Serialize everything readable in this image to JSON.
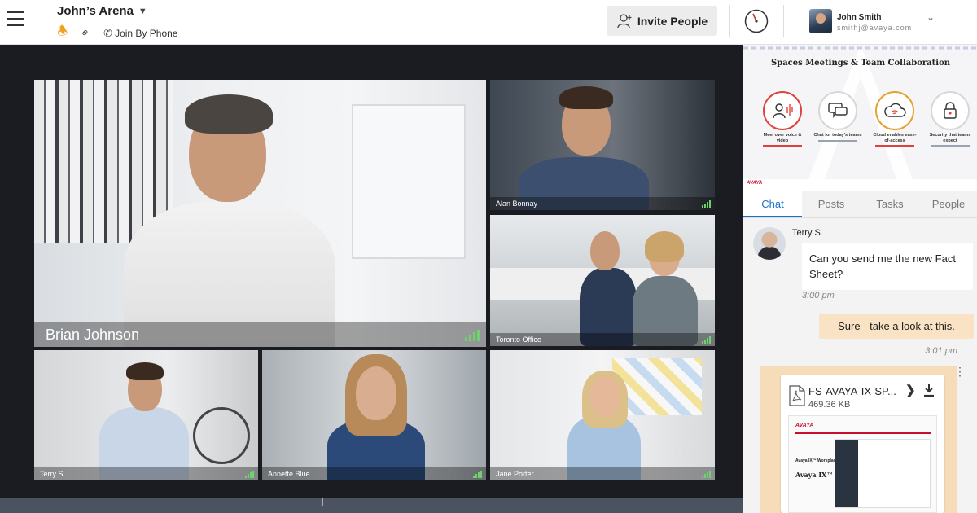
{
  "header": {
    "space_title": "John’s Arena",
    "join_by_phone": "Join By Phone",
    "invite_label": "Invite People",
    "user": {
      "name": "John Smith",
      "email": "smithj@avaya.com"
    }
  },
  "video": {
    "tiles": [
      {
        "name": "Brian Johnson"
      },
      {
        "name": "Alan Bonnay"
      },
      {
        "name": "Toronto Office"
      },
      {
        "name": "Terry S."
      },
      {
        "name": "Annette Blue"
      },
      {
        "name": "Jane Porter"
      }
    ]
  },
  "banner": {
    "title": "Spaces Meetings & Team Collaboration",
    "features": [
      {
        "caption": "Meet over voice & video",
        "icon": "person-voice-icon",
        "accent": "#e0413b"
      },
      {
        "caption": "Chat for today's teams",
        "icon": "chat-icon",
        "accent": "#9aa4b0"
      },
      {
        "caption": "Cloud enables ease-of-access",
        "icon": "cloud-icon",
        "accent": "#e0413b"
      },
      {
        "caption": "Security that teams expect",
        "icon": "lock-icon",
        "accent": "#9aa4b0"
      }
    ],
    "brand": "AVAYA"
  },
  "tabs": [
    {
      "label": "Chat",
      "active": true
    },
    {
      "label": "Posts",
      "active": false
    },
    {
      "label": "Tasks",
      "active": false
    },
    {
      "label": "People",
      "active": false
    }
  ],
  "chat": {
    "messages": [
      {
        "sender": "Terry S",
        "text": "Can you send me the new Fact Sheet?",
        "time": "3:00 pm"
      },
      {
        "text": "Sure - take a look at this.",
        "time": "3:01 pm"
      }
    ],
    "attachment": {
      "file_name": "FS-AVAYA-IX-SP...",
      "size": "469.36 KB",
      "preview": {
        "brand": "AVAYA",
        "subtitle": "Avaya IX™ Workplace",
        "title": "Avaya IX™ Spaces"
      }
    }
  },
  "colors": {
    "accent_blue": "#1a73c9",
    "outgoing_bubble": "#fae3c4",
    "video_bg": "#1b1b22",
    "signal_green": "#6dd46a"
  }
}
